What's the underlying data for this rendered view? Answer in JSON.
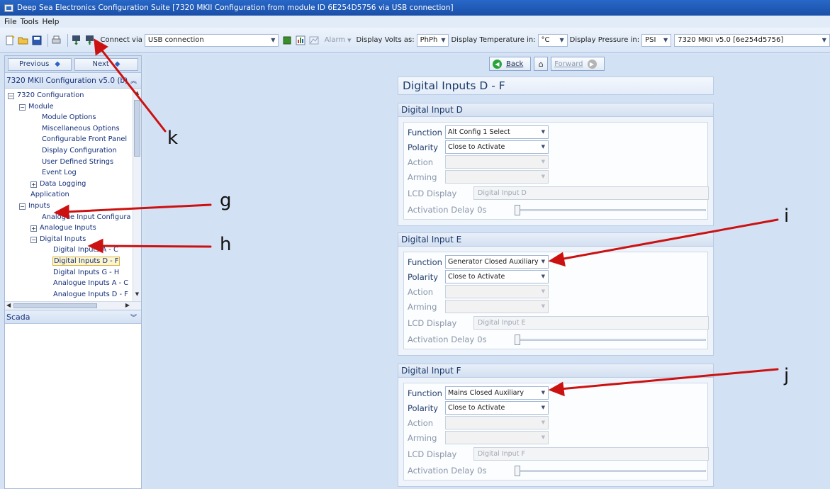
{
  "window": {
    "title": "Deep Sea Electronics Configuration Suite [7320 MKII Configuration from module ID 6E254D5756 via USB connection]"
  },
  "menu": {
    "items": [
      "File",
      "Tools",
      "Help"
    ]
  },
  "toolbar": {
    "connect_via_label": "Connect via",
    "connect_via_value": "USB connection",
    "alarm_label": "Alarm",
    "display_volts_label": "Display Volts as:",
    "display_volts_value": "PhPh",
    "display_temp_label": "Display Temperature in:",
    "display_temp_value": "°C",
    "display_pressure_label": "Display Pressure in:",
    "display_pressure_value": "PSI",
    "module_value": "7320 MKII v5.0 [6e254d5756]"
  },
  "leftnav": {
    "previous_label": "Previous",
    "next_label": "Next",
    "panel_title": "7320 MKII Configuration v5.0 (b)",
    "scada_label": "Scada",
    "tree": [
      {
        "label": "7320 Configuration",
        "expander": "−",
        "indent": 0
      },
      {
        "label": "Module",
        "expander": "−",
        "indent": 1
      },
      {
        "label": "Module Options",
        "indent": 3
      },
      {
        "label": "Miscellaneous Options",
        "indent": 3
      },
      {
        "label": "Configurable Front Panel",
        "indent": 3
      },
      {
        "label": "Display Configuration",
        "indent": 3
      },
      {
        "label": "User Defined Strings",
        "indent": 3
      },
      {
        "label": "Event Log",
        "indent": 3
      },
      {
        "label": "Data Logging",
        "expander": "+",
        "indent": 2
      },
      {
        "label": "Application",
        "indent": 2
      },
      {
        "label": "Inputs",
        "expander": "−",
        "indent": 1
      },
      {
        "label": "Analogue Input Configura",
        "indent": 3
      },
      {
        "label": "Analogue Inputs",
        "expander": "+",
        "indent": 2
      },
      {
        "label": "Digital Inputs",
        "expander": "−",
        "indent": 2
      },
      {
        "label": "Digital Inputs A - C",
        "indent": 4
      },
      {
        "label": "Digital Inputs D - F",
        "indent": 4,
        "selected": true
      },
      {
        "label": "Digital Inputs G - H",
        "indent": 4
      },
      {
        "label": "Analogue Inputs A - C",
        "indent": 4
      },
      {
        "label": "Analogue Inputs D - F",
        "indent": 4
      }
    ]
  },
  "nav": {
    "back_label": "Back",
    "forward_label": "Forward"
  },
  "page": {
    "title": "Digital Inputs D - F",
    "groups": [
      {
        "title": "Digital Input D",
        "function_label": "Function",
        "function_value": "Alt Config 1 Select",
        "polarity_label": "Polarity",
        "polarity_value": "Close to Activate",
        "action_label": "Action",
        "arming_label": "Arming",
        "lcd_label": "LCD Display",
        "lcd_value": "Digital Input D",
        "delay_label": "Activation Delay",
        "delay_value": "0s"
      },
      {
        "title": "Digital Input E",
        "function_label": "Function",
        "function_value": "Generator Closed Auxiliary",
        "polarity_label": "Polarity",
        "polarity_value": "Close to Activate",
        "action_label": "Action",
        "arming_label": "Arming",
        "lcd_label": "LCD Display",
        "lcd_value": "Digital Input E",
        "delay_label": "Activation Delay",
        "delay_value": "0s"
      },
      {
        "title": "Digital Input F",
        "function_label": "Function",
        "function_value": "Mains Closed Auxiliary",
        "polarity_label": "Polarity",
        "polarity_value": "Close to Activate",
        "action_label": "Action",
        "arming_label": "Arming",
        "lcd_label": "LCD Display",
        "lcd_value": "Digital Input F",
        "delay_label": "Activation Delay",
        "delay_value": "0s"
      }
    ]
  },
  "annotations": {
    "k": "k",
    "g": "g",
    "h": "h",
    "i": "i",
    "j": "j"
  },
  "colors": {
    "annotation_arrow": "#cc1111",
    "title_bar": "#1f5bb8"
  }
}
